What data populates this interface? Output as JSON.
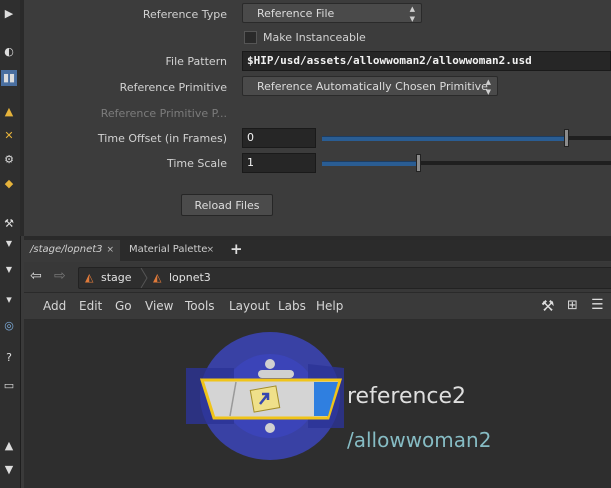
{
  "params": {
    "reference_type": {
      "label": "Reference Type",
      "value": "Reference File"
    },
    "make_instanceable": {
      "label": "Make Instanceable",
      "checked": false
    },
    "file_pattern": {
      "label": "File Pattern",
      "value": "$HIP/usd/assets/allowwoman2/allowwoman2.usd"
    },
    "reference_primitive": {
      "label": "Reference Primitive",
      "value": "Reference Automatically Chosen Primitive"
    },
    "reference_primitive_path": {
      "label": "Reference Primitive P..."
    },
    "time_offset": {
      "label": "Time Offset (in Frames)",
      "value": "0",
      "level": 0.83
    },
    "time_scale": {
      "label": "Time Scale",
      "value": "1",
      "level": 0.34
    },
    "reload_button": "Reload Files"
  },
  "tabs": [
    {
      "label": "/stage/lopnet3",
      "close": "×"
    },
    {
      "label": "Material Palette",
      "close": "×"
    }
  ],
  "new_tab": "+",
  "breadcrumb": [
    {
      "label": "stage"
    },
    {
      "label": "lopnet3"
    }
  ],
  "menu": [
    "Add",
    "Edit",
    "Go",
    "View",
    "Tools",
    "Layout",
    "Labs",
    "Help"
  ],
  "node": {
    "name": "reference2",
    "path": "/allowwoman2"
  },
  "colors": {
    "accent": "#2a5d93",
    "node_ring": "#3b44b8",
    "node_outline": "#f0c419",
    "node_path": "#86bcc4"
  },
  "icons": [
    "back-arrow-icon",
    "forward-arrow-icon",
    "wrench-icon",
    "tree-icon",
    "list-icon",
    "reference-node-icon"
  ]
}
